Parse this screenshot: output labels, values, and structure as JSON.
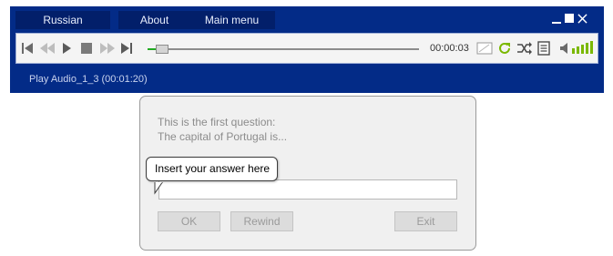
{
  "menu": {
    "language": "Russian",
    "about": "About",
    "main_menu": "Main menu"
  },
  "player": {
    "time": "00:00:03",
    "progress": 0.04,
    "volume_bars": 5,
    "status": "Play Audio_1_3 (00:01:20)"
  },
  "question": {
    "line1": "This is the first question:",
    "line2": "The capital of Portugal is...",
    "answer_value": "",
    "tooltip": "Insert your answer here"
  },
  "buttons": {
    "ok": "OK",
    "rewind": "Rewind",
    "exit": "Exit"
  },
  "colors": {
    "window": "#032b87",
    "accent_green": "#7ab800"
  }
}
